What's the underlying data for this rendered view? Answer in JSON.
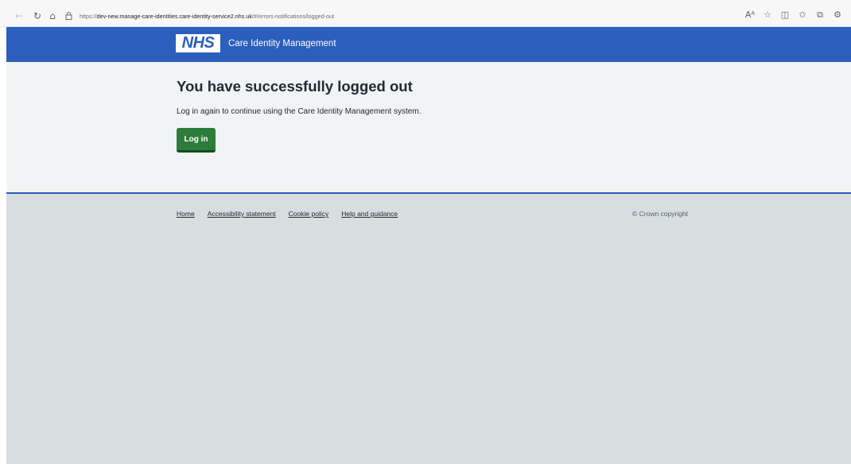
{
  "browser": {
    "url_prefix": "https://",
    "url_host": "dev-new.manage-care-identities.care-identity-service2.nhs.uk",
    "url_path": "/#/errors-notifications/logged-out",
    "icons": [
      "back-arrow-icon",
      "reload-icon",
      "home-icon",
      "lock-icon",
      "read-aloud-icon",
      "favorite-star-icon",
      "split-screen-icon",
      "favorites-icon",
      "collections-icon",
      "extensions-icon"
    ]
  },
  "header": {
    "logo_text": "NHS",
    "service_name": "Care Identity Management",
    "color": "#2b5ebd"
  },
  "main": {
    "title": "You have successfully logged out",
    "body": "Log in again to continue using the Care Identity Management system.",
    "login_label": "Log in",
    "button_color": "#2d7d3a"
  },
  "footer": {
    "links": [
      "Home",
      "Accessibility statement",
      "Cookie policy",
      "Help and guidance"
    ],
    "copyright": "© Crown copyright"
  }
}
